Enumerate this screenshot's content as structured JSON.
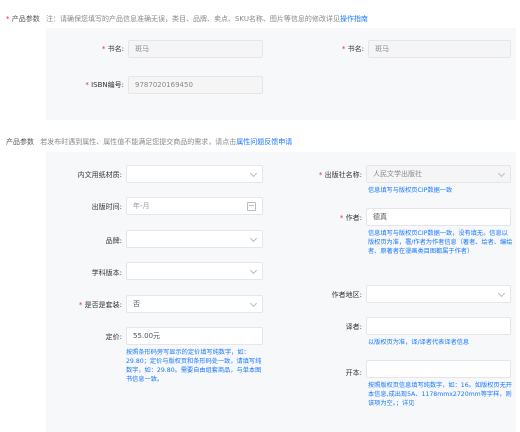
{
  "top": {
    "required_mark": "*",
    "section_label": "产品参数",
    "note_prefix": "注：请确保您填写的产品信息准确无误，类目、品牌、卖点、SKU名称、图片等信息的修改详见",
    "note_link": "操作指南"
  },
  "basic": {
    "book_name_left": {
      "label": "书名:",
      "value": "斑马"
    },
    "book_name_right": {
      "label": "书名:",
      "value": "斑马"
    },
    "isbn": {
      "label": "ISBN编号:",
      "value": "9787020169450"
    }
  },
  "params": {
    "section_label": "产品参数",
    "note_prefix": "若发布时遇到属性、属性值不能满足您提交商品的需求，请点击",
    "note_link": "属性问题反馈申请"
  },
  "left_fields": {
    "paper": {
      "label": "内文用纸材质:",
      "value": ""
    },
    "pub_time": {
      "label": "出版时间:",
      "placeholder": "年-月"
    },
    "brand": {
      "label": "品牌:",
      "value": ""
    },
    "subject": {
      "label": "学科版本:",
      "value": ""
    },
    "is_set": {
      "label": "是否是套装:",
      "value": "否"
    },
    "price": {
      "label": "定价:",
      "value": "55.00元",
      "hint": "按照条形码旁写显示的定价填写纯数字，如：29.80；定价与版权页和条形码处一致，请填写纯数字，如：29.80。需要自由组套商品，与单本图书信息一致。"
    }
  },
  "right_fields": {
    "publisher": {
      "label": "出版社名称:",
      "value": "人民文学出版社",
      "hint": "信息填写与版权页CIP数据一致"
    },
    "author": {
      "label": "作者:",
      "value": "德真",
      "hint": "信息填写与版权页CIP数据一致，没有填无。信息以版权页为准，署/作者为作者信息（著者、绘者、编绘者、原著者在漫画类目图都属于作者）"
    },
    "region": {
      "label": "作者地区:",
      "value": ""
    },
    "translator": {
      "label": "译者:",
      "value": "",
      "hint": "以版权页为准，译/译者代表译者信息"
    },
    "format": {
      "label": "开本:",
      "value": "",
      "hint": "按照版权页信息填写纯数字，如：16。如版权页无开本信息,成出现5A、1178mmx2720mm等字样，则该项为空。；详见"
    }
  },
  "colors": {
    "accent": "#1677ff",
    "required": "#f5222d",
    "panel": "#f7f8fa"
  }
}
